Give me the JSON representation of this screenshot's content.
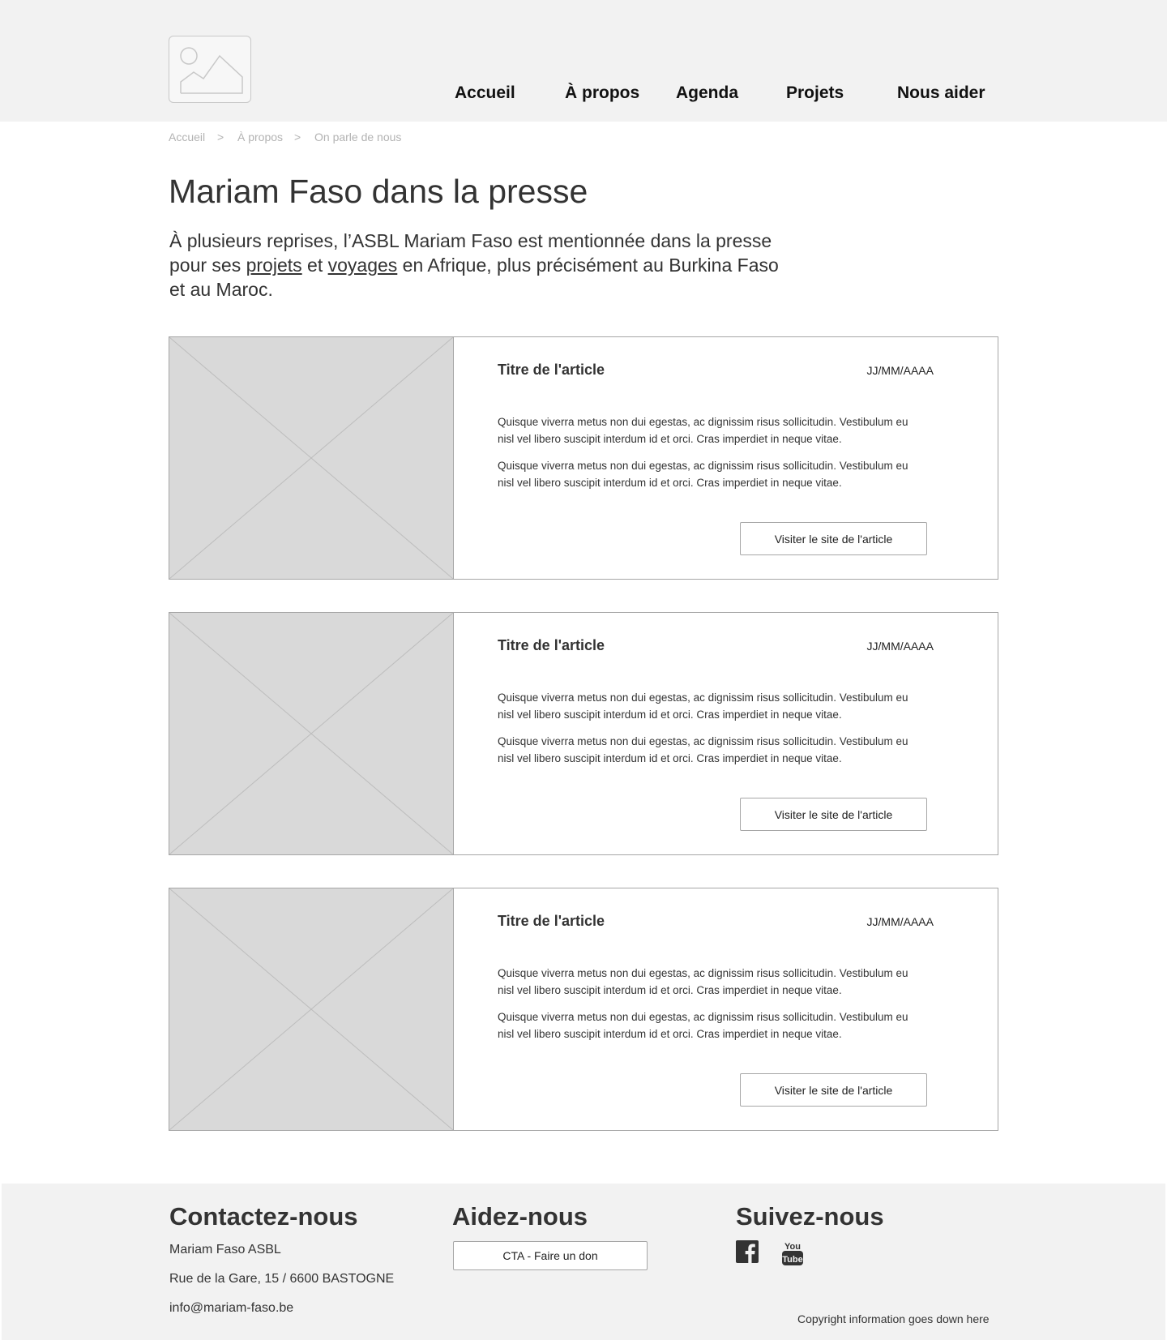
{
  "nav": {
    "items": [
      {
        "label": "Accueil"
      },
      {
        "label": "À propos"
      },
      {
        "label": "Agenda"
      },
      {
        "label": "Projets"
      },
      {
        "label": "Nous aider"
      }
    ]
  },
  "breadcrumb": {
    "items": [
      "Accueil",
      "À propos",
      "On parle de nous"
    ],
    "separator": ">"
  },
  "page": {
    "title": "Mariam Faso dans la presse",
    "intro_part1": "À plusieurs reprises, l’ASBL Mariam Faso est mentionnée dans la presse pour ses ",
    "intro_link1": "projets",
    "intro_part2": " et ",
    "intro_link2": "voyages",
    "intro_part3": " en Afrique, plus précisément au Burkina Faso et au Maroc."
  },
  "articles": [
    {
      "title": "Titre de l'article",
      "date": "JJ/MM/AAAA",
      "para1": "Quisque viverra metus non dui egestas, ac dignissim risus sollicitudin. Vestibulum eu nisl vel libero suscipit interdum id et orci. Cras imperdiet in neque vitae.",
      "para2": "Quisque viverra metus non dui egestas, ac dignissim risus sollicitudin. Vestibulum eu nisl vel libero suscipit interdum id et orci. Cras imperdiet in neque vitae.",
      "button": "Visiter le site de l'article"
    },
    {
      "title": "Titre de l'article",
      "date": "JJ/MM/AAAA",
      "para1": "Quisque viverra metus non dui egestas, ac dignissim risus sollicitudin. Vestibulum eu nisl vel libero suscipit interdum id et orci. Cras imperdiet in neque vitae.",
      "para2": "Quisque viverra metus non dui egestas, ac dignissim risus sollicitudin. Vestibulum eu nisl vel libero suscipit interdum id et orci. Cras imperdiet in neque vitae.",
      "button": "Visiter le site de l'article"
    },
    {
      "title": "Titre de l'article",
      "date": "JJ/MM/AAAA",
      "para1": "Quisque viverra metus non dui egestas, ac dignissim risus sollicitudin. Vestibulum eu nisl vel libero suscipit interdum id et orci. Cras imperdiet in neque vitae.",
      "para2": "Quisque viverra metus non dui egestas, ac dignissim risus sollicitudin. Vestibulum eu nisl vel libero suscipit interdum id et orci. Cras imperdiet in neque vitae.",
      "button": "Visiter le site de l'article"
    }
  ],
  "footer": {
    "contact": {
      "heading": "Contactez-nous",
      "name": "Mariam Faso ASBL",
      "address": "Rue de la Gare, 15 / 6600 BASTOGNE",
      "email": "info@mariam-faso.be"
    },
    "help": {
      "heading": "Aidez-nous",
      "button": "CTA - Faire un don"
    },
    "follow": {
      "heading": "Suivez-nous",
      "icons": [
        "facebook-icon",
        "youtube-icon"
      ]
    },
    "copyright": "Copyright information goes down here"
  },
  "colors": {
    "header_bg": "#f2f2f2",
    "footer_bg": "#f2f2f2",
    "placeholder": "#d9d9d9",
    "border": "#a6a6a6",
    "text": "#333333",
    "muted": "#b3b3b3"
  }
}
